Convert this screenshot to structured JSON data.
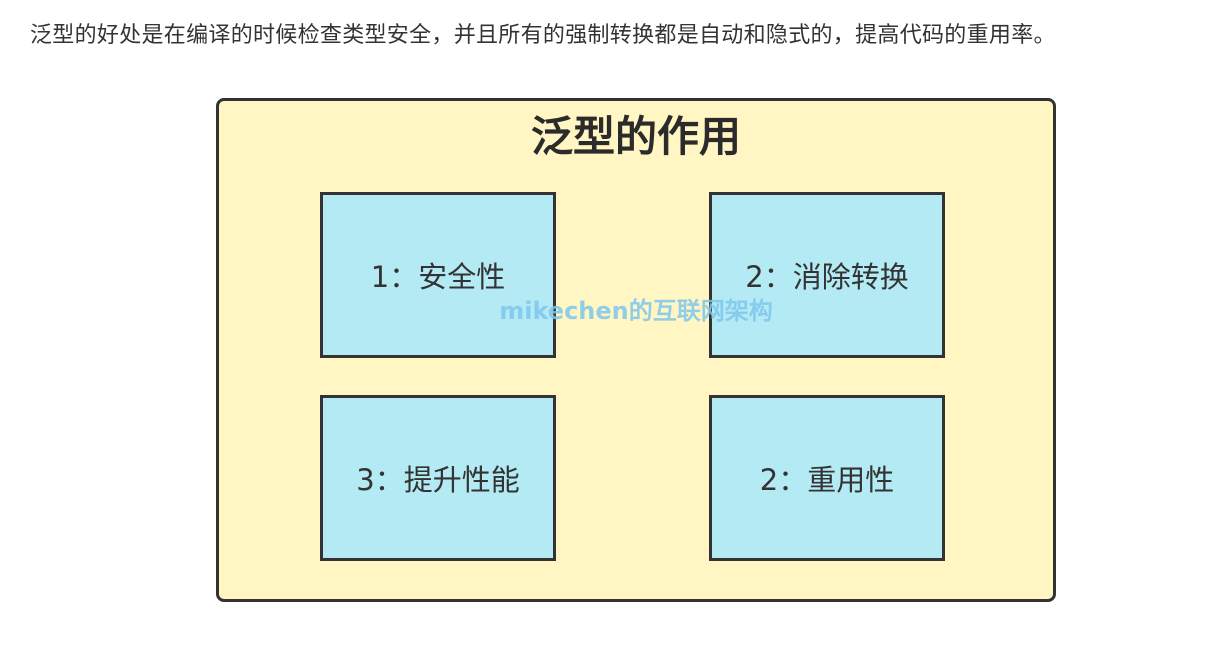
{
  "intro_text": "泛型的好处是在编译的时候检查类型安全，并且所有的强制转换都是自动和隐式的，提高代码的重用率。",
  "diagram": {
    "title": "泛型的作用",
    "boxes": [
      {
        "label": "1：安全性"
      },
      {
        "label": "2：消除转换"
      },
      {
        "label": "3：提升性能"
      },
      {
        "label": "2：重用性"
      }
    ],
    "watermark": "mikechen的互联网架构",
    "colors": {
      "container_fill": "#fff6c4",
      "box_fill": "#b3eaf3",
      "border": "#333333",
      "watermark": "#7fc7ee"
    }
  }
}
